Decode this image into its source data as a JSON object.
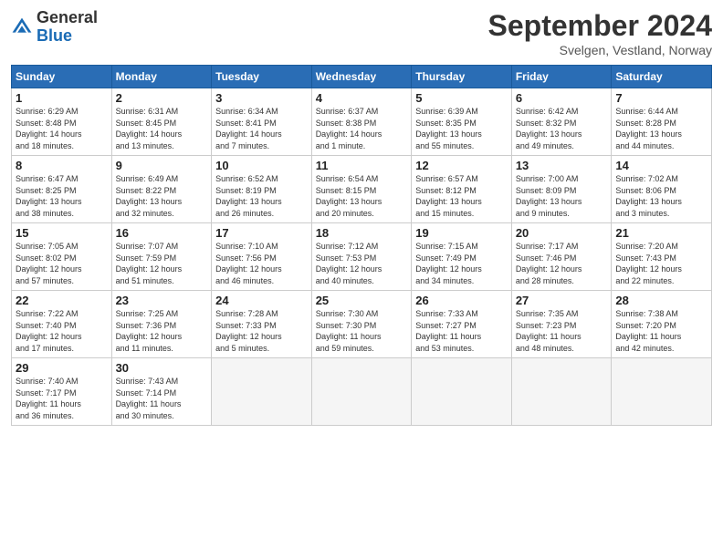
{
  "logo": {
    "general": "General",
    "blue": "Blue"
  },
  "title": {
    "month_year": "September 2024",
    "location": "Svelgen, Vestland, Norway"
  },
  "days_of_week": [
    "Sunday",
    "Monday",
    "Tuesday",
    "Wednesday",
    "Thursday",
    "Friday",
    "Saturday"
  ],
  "weeks": [
    [
      {
        "num": "1",
        "info": "Sunrise: 6:29 AM\nSunset: 8:48 PM\nDaylight: 14 hours\nand 18 minutes."
      },
      {
        "num": "2",
        "info": "Sunrise: 6:31 AM\nSunset: 8:45 PM\nDaylight: 14 hours\nand 13 minutes."
      },
      {
        "num": "3",
        "info": "Sunrise: 6:34 AM\nSunset: 8:41 PM\nDaylight: 14 hours\nand 7 minutes."
      },
      {
        "num": "4",
        "info": "Sunrise: 6:37 AM\nSunset: 8:38 PM\nDaylight: 14 hours\nand 1 minute."
      },
      {
        "num": "5",
        "info": "Sunrise: 6:39 AM\nSunset: 8:35 PM\nDaylight: 13 hours\nand 55 minutes."
      },
      {
        "num": "6",
        "info": "Sunrise: 6:42 AM\nSunset: 8:32 PM\nDaylight: 13 hours\nand 49 minutes."
      },
      {
        "num": "7",
        "info": "Sunrise: 6:44 AM\nSunset: 8:28 PM\nDaylight: 13 hours\nand 44 minutes."
      }
    ],
    [
      {
        "num": "8",
        "info": "Sunrise: 6:47 AM\nSunset: 8:25 PM\nDaylight: 13 hours\nand 38 minutes."
      },
      {
        "num": "9",
        "info": "Sunrise: 6:49 AM\nSunset: 8:22 PM\nDaylight: 13 hours\nand 32 minutes."
      },
      {
        "num": "10",
        "info": "Sunrise: 6:52 AM\nSunset: 8:19 PM\nDaylight: 13 hours\nand 26 minutes."
      },
      {
        "num": "11",
        "info": "Sunrise: 6:54 AM\nSunset: 8:15 PM\nDaylight: 13 hours\nand 20 minutes."
      },
      {
        "num": "12",
        "info": "Sunrise: 6:57 AM\nSunset: 8:12 PM\nDaylight: 13 hours\nand 15 minutes."
      },
      {
        "num": "13",
        "info": "Sunrise: 7:00 AM\nSunset: 8:09 PM\nDaylight: 13 hours\nand 9 minutes."
      },
      {
        "num": "14",
        "info": "Sunrise: 7:02 AM\nSunset: 8:06 PM\nDaylight: 13 hours\nand 3 minutes."
      }
    ],
    [
      {
        "num": "15",
        "info": "Sunrise: 7:05 AM\nSunset: 8:02 PM\nDaylight: 12 hours\nand 57 minutes."
      },
      {
        "num": "16",
        "info": "Sunrise: 7:07 AM\nSunset: 7:59 PM\nDaylight: 12 hours\nand 51 minutes."
      },
      {
        "num": "17",
        "info": "Sunrise: 7:10 AM\nSunset: 7:56 PM\nDaylight: 12 hours\nand 46 minutes."
      },
      {
        "num": "18",
        "info": "Sunrise: 7:12 AM\nSunset: 7:53 PM\nDaylight: 12 hours\nand 40 minutes."
      },
      {
        "num": "19",
        "info": "Sunrise: 7:15 AM\nSunset: 7:49 PM\nDaylight: 12 hours\nand 34 minutes."
      },
      {
        "num": "20",
        "info": "Sunrise: 7:17 AM\nSunset: 7:46 PM\nDaylight: 12 hours\nand 28 minutes."
      },
      {
        "num": "21",
        "info": "Sunrise: 7:20 AM\nSunset: 7:43 PM\nDaylight: 12 hours\nand 22 minutes."
      }
    ],
    [
      {
        "num": "22",
        "info": "Sunrise: 7:22 AM\nSunset: 7:40 PM\nDaylight: 12 hours\nand 17 minutes."
      },
      {
        "num": "23",
        "info": "Sunrise: 7:25 AM\nSunset: 7:36 PM\nDaylight: 12 hours\nand 11 minutes."
      },
      {
        "num": "24",
        "info": "Sunrise: 7:28 AM\nSunset: 7:33 PM\nDaylight: 12 hours\nand 5 minutes."
      },
      {
        "num": "25",
        "info": "Sunrise: 7:30 AM\nSunset: 7:30 PM\nDaylight: 11 hours\nand 59 minutes."
      },
      {
        "num": "26",
        "info": "Sunrise: 7:33 AM\nSunset: 7:27 PM\nDaylight: 11 hours\nand 53 minutes."
      },
      {
        "num": "27",
        "info": "Sunrise: 7:35 AM\nSunset: 7:23 PM\nDaylight: 11 hours\nand 48 minutes."
      },
      {
        "num": "28",
        "info": "Sunrise: 7:38 AM\nSunset: 7:20 PM\nDaylight: 11 hours\nand 42 minutes."
      }
    ],
    [
      {
        "num": "29",
        "info": "Sunrise: 7:40 AM\nSunset: 7:17 PM\nDaylight: 11 hours\nand 36 minutes."
      },
      {
        "num": "30",
        "info": "Sunrise: 7:43 AM\nSunset: 7:14 PM\nDaylight: 11 hours\nand 30 minutes."
      },
      {
        "num": "",
        "info": ""
      },
      {
        "num": "",
        "info": ""
      },
      {
        "num": "",
        "info": ""
      },
      {
        "num": "",
        "info": ""
      },
      {
        "num": "",
        "info": ""
      }
    ]
  ]
}
